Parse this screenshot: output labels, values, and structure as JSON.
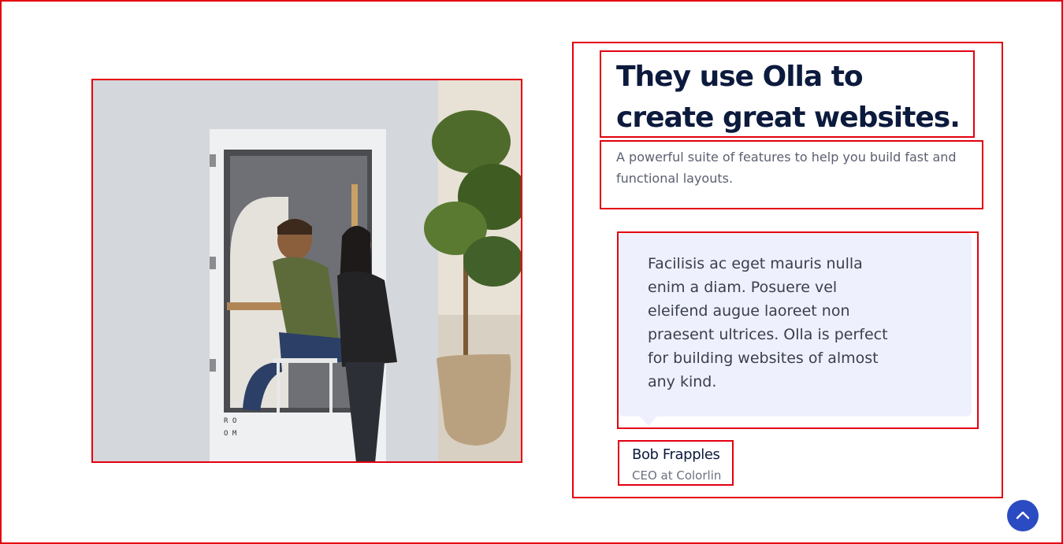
{
  "hero": {
    "photo_alt": "Man and woman next to a phone booth office pod",
    "photo_booth_text": [
      "R O",
      "O M"
    ]
  },
  "testimonial_section": {
    "title": "They use Olla to create great websites.",
    "subtitle": "A powerful suite of features to help you build fast and functional layouts.",
    "quote": "Facilisis ac eget mauris nulla enim a diam. Posuere vel eleifend augue laoreet non praesent ultrices. Olla is perfect for building websites of almost any kind.",
    "author_name": "Bob Frapples",
    "author_role": "CEO at Colorlin"
  },
  "scroll_top": {
    "icon": "chevron-up-icon",
    "color": "#2b4bc2"
  },
  "colors": {
    "heading": "#0c1a3d",
    "quote_background": "#eef1fd",
    "annotation_border": "#e3000f"
  }
}
